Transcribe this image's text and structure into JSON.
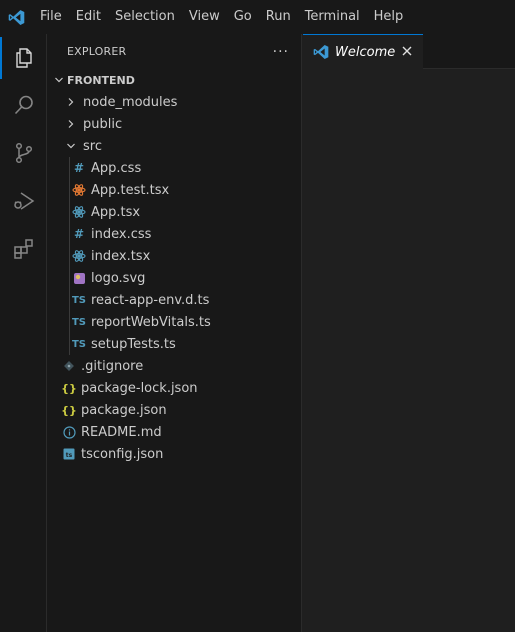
{
  "menu": [
    "File",
    "Edit",
    "Selection",
    "View",
    "Go",
    "Run",
    "Terminal",
    "Help"
  ],
  "sidebar": {
    "title": "EXPLORER",
    "more": "···",
    "root": "FRONTEND",
    "items": [
      {
        "label": "node_modules",
        "kind": "folder-closed"
      },
      {
        "label": "public",
        "kind": "folder-closed"
      },
      {
        "label": "src",
        "kind": "folder-open"
      },
      {
        "label": "App.css",
        "kind": "css-icon"
      },
      {
        "label": "App.test.tsx",
        "kind": "test-react-icon"
      },
      {
        "label": "App.tsx",
        "kind": "react-icon"
      },
      {
        "label": "index.css",
        "kind": "css-icon"
      },
      {
        "label": "index.tsx",
        "kind": "react-icon"
      },
      {
        "label": "logo.svg",
        "kind": "svg-icon"
      },
      {
        "label": "react-app-env.d.ts",
        "kind": "ts-icon"
      },
      {
        "label": "reportWebVitals.ts",
        "kind": "ts-icon"
      },
      {
        "label": "setupTests.ts",
        "kind": "ts-icon"
      },
      {
        "label": ".gitignore",
        "kind": "git-icon"
      },
      {
        "label": "package-lock.json",
        "kind": "json-icon"
      },
      {
        "label": "package.json",
        "kind": "json-icon"
      },
      {
        "label": "README.md",
        "kind": "info-icon"
      },
      {
        "label": "tsconfig.json",
        "kind": "tsconfig-icon"
      }
    ]
  },
  "editor": {
    "tab_label": "Welcome",
    "close_glyph": "✕"
  },
  "colors": {
    "accent": "#0078d4",
    "ts": "#519aba",
    "json": "#cbcb41",
    "test": "#e37933",
    "svg": "#a074c4"
  }
}
